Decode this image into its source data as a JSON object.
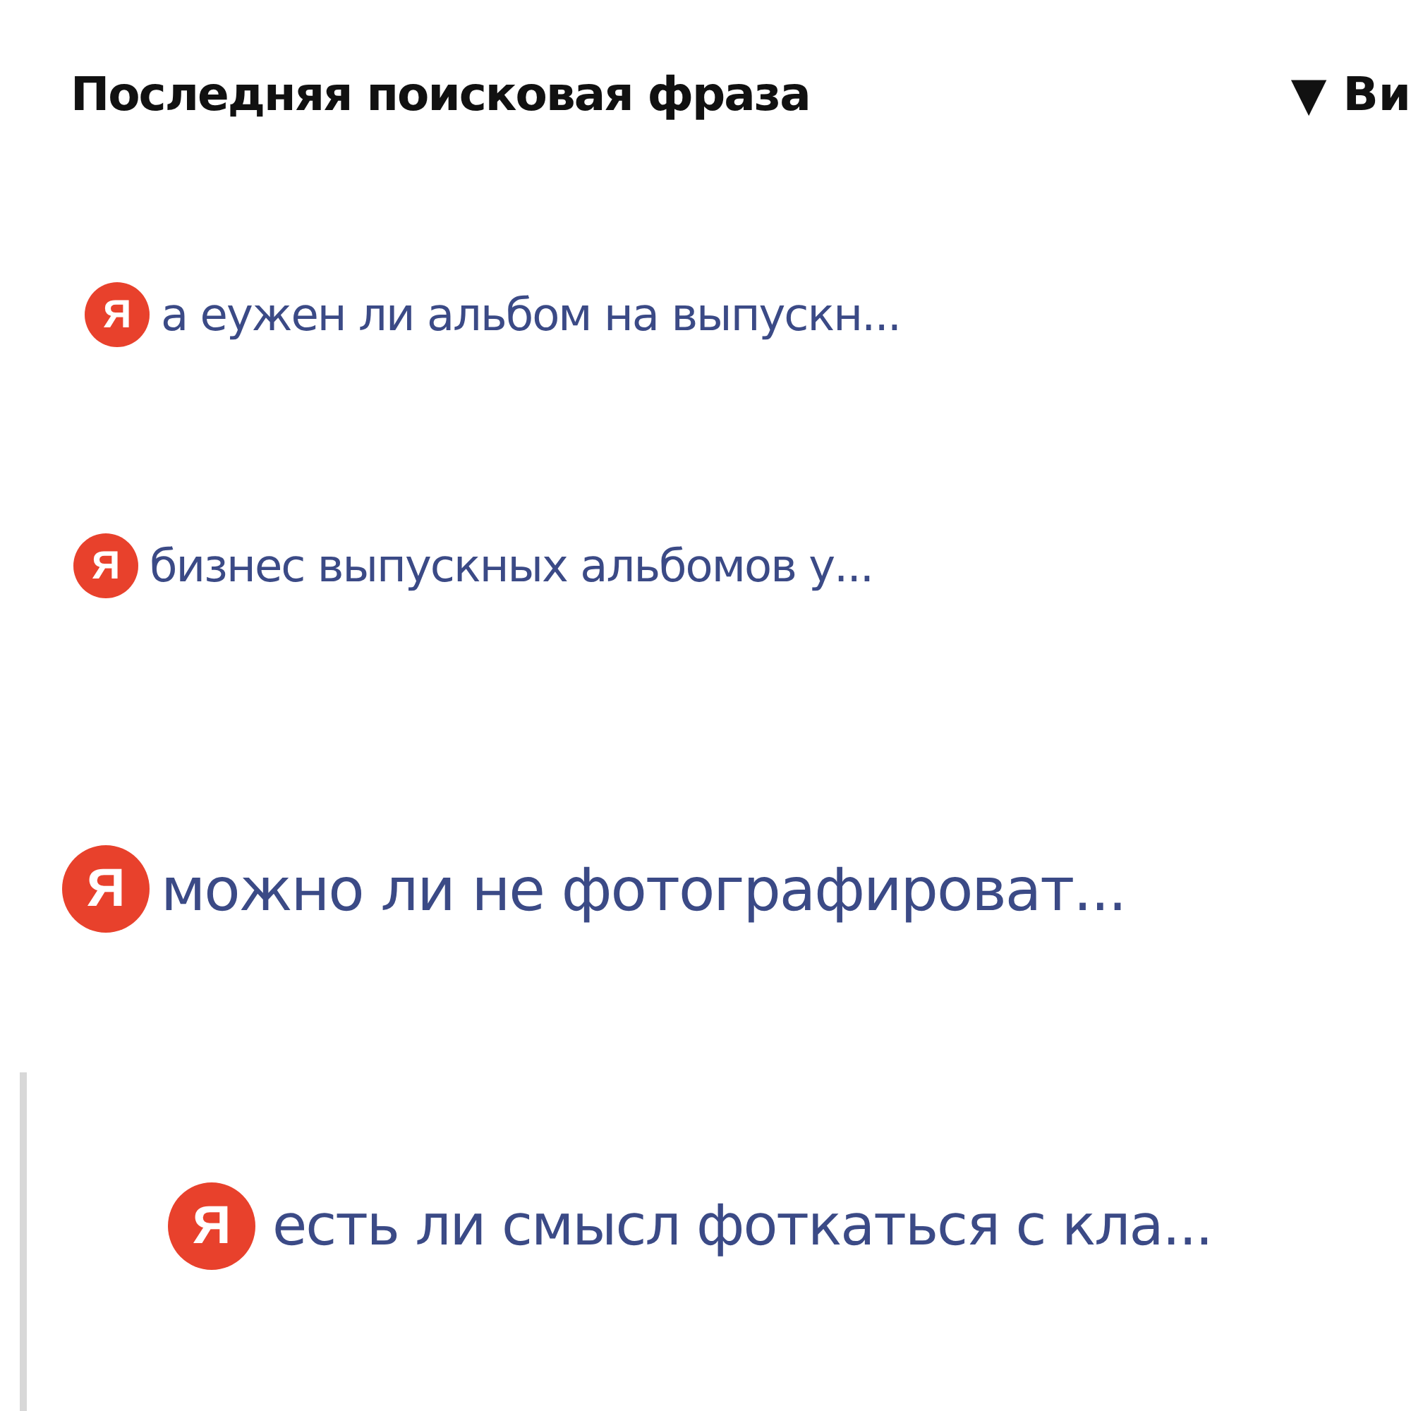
{
  "header": {
    "title": "Последняя поисковая фраза",
    "sort": "▼ Ви"
  },
  "panels": [
    {
      "kind": "small",
      "rows": [
        {
          "badge": "Я",
          "text": "а еужен ли альбом на выпускн..."
        },
        {
          "badge": "Я",
          "text": "бизнес выпускных альбомов у..."
        }
      ]
    },
    {
      "kind": "large",
      "rows": [
        {
          "badge": "Я",
          "text": "можно ли не фотографироват..."
        }
      ]
    },
    {
      "kind": "bordered",
      "rows": [
        {
          "badge": "Я",
          "text": "есть ли смысл фоткаться с кла..."
        }
      ]
    }
  ]
}
